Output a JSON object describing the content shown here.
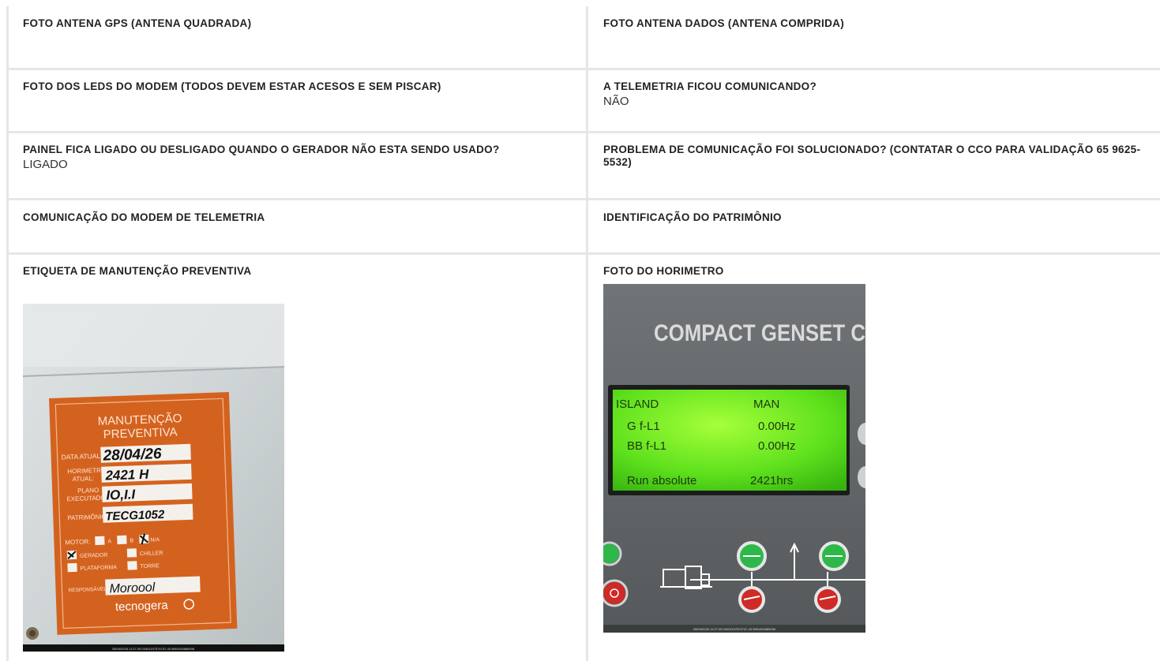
{
  "rows": [
    {
      "left": {
        "label": "FOTO ANTENA GPS (ANTENA QUADRADA)",
        "value": ""
      },
      "right": {
        "label": "FOTO ANTENA DADOS (ANTENA COMPRIDA)",
        "value": ""
      }
    },
    {
      "left": {
        "label": "FOTO DOS LEDS DO MODEM (TODOS DEVEM ESTAR ACESOS E SEM PISCAR)",
        "value": ""
      },
      "right": {
        "label": "A TELEMETRIA FICOU COMUNICANDO?",
        "value": "NÃO"
      }
    },
    {
      "left": {
        "label": "PAINEL FICA LIGADO OU DESLIGADO QUANDO O GERADOR NÃO ESTA SENDO USADO?",
        "value": "LIGADO"
      },
      "right": {
        "label": "PROBLEMA DE COMUNICAÇÃO FOI SOLUCIONADO? (CONTATAR O CCO PARA VALIDAÇÃO 65 9625-5532)",
        "value": ""
      }
    },
    {
      "left": {
        "label": "COMUNICAÇÃO DO MODEM DE TELEMETRIA",
        "value": ""
      },
      "right": {
        "label": "IDENTIFICAÇÃO DO PATRIMÔNIO",
        "value": ""
      }
    },
    {
      "left": {
        "label": "ETIQUETA DE MANUTENÇÃO PREVENTIVA",
        "value": ""
      },
      "right": {
        "label": "FOTO DO HORIMETRO",
        "value": ""
      }
    }
  ],
  "label_photo": {
    "title_line1": "MANUTENÇÃO",
    "title_line2": "PREVENTIVA",
    "data_atual_label": "DATA ATUAL:",
    "data_atual_value": "28/04/26",
    "horimetro_label_1": "HORIMETRO",
    "horimetro_label_2": "ATUAL:",
    "horimetro_value": "2421 H",
    "plano_label_1": "PLANO",
    "plano_label_2": "EXECUTADO:",
    "plano_value": "IO,I.I",
    "patrimonio_label": "PATRIMÔNIO:",
    "patrimonio_value": "TECG1052",
    "motor_label": "MOTOR:",
    "opt_a": "A",
    "opt_b": "B",
    "opt_na": "N/A",
    "opt_gerador": "GERADOR",
    "opt_chiller": "CHILLER",
    "opt_plataforma": "PLATAFORMA",
    "opt_torre": "TORRE",
    "responsavel_label": "RESPONSÁVEL:",
    "responsavel_value": "Moroool",
    "brand": "tecnogera",
    "timestamp": "28/04/2026 11:27:25 03401197574747-43 9851254689496"
  },
  "horimetro_photo": {
    "panel_title": "COMPACT GENSET C",
    "lcd_row1_left": "ISLAND",
    "lcd_row1_right": "MAN",
    "lcd_row2_left": "G  f-L1",
    "lcd_row2_right": "0.00Hz",
    "lcd_row3_left": "BB f-L1",
    "lcd_row3_right": "0.00Hz",
    "lcd_row4_left": "Run absolute",
    "lcd_row4_right": "2421hrs",
    "timestamp": "28/04/2026 11:27:25 03401197574747-43 9851254689496"
  }
}
